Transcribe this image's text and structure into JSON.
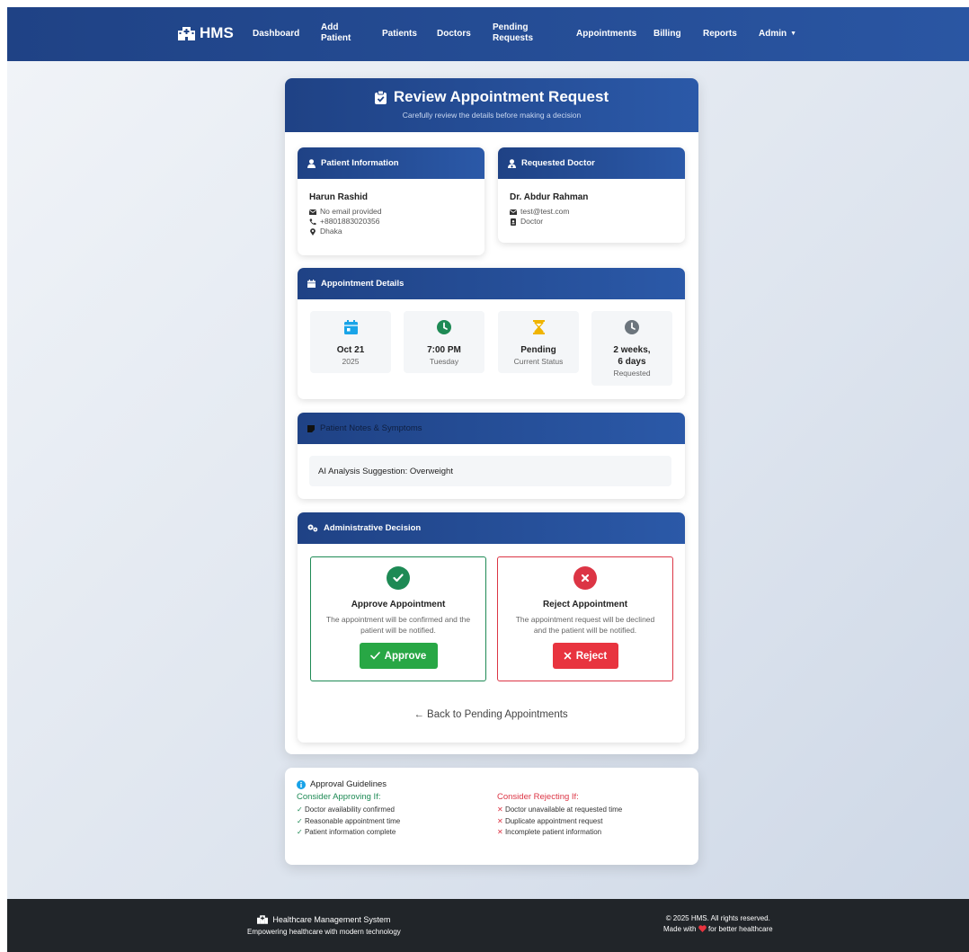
{
  "nav": {
    "brand": "HMS",
    "links": [
      "Dashboard",
      "Add Patient",
      "Patients",
      "Doctors",
      "Pending Requests",
      "Appointments",
      "Billing",
      "Reports"
    ],
    "admin": "Admin"
  },
  "header": {
    "title": "Review Appointment Request",
    "subtitle": "Carefully review the details before making a decision"
  },
  "patient": {
    "heading": "Patient Information",
    "name": "Harun Rashid",
    "email": "No email provided",
    "phone": "+8801883020356",
    "location": "Dhaka"
  },
  "doctor": {
    "heading": "Requested Doctor",
    "name": "Dr. Abdur Rahman",
    "email": "test@test.com",
    "role": "Doctor"
  },
  "details": {
    "heading": "Appointment Details",
    "date_main": "Oct 21",
    "date_sub": "2025",
    "time_main": "7:00 PM",
    "time_sub": "Tuesday",
    "status_main": "Pending",
    "status_sub": "Current Status",
    "ago_main_1": "2 weeks,",
    "ago_main_2": "6 days",
    "ago_sub": "Requested"
  },
  "notes": {
    "heading": "Patient Notes & Symptoms",
    "text": "AI Analysis Suggestion: Overweight"
  },
  "decision": {
    "heading": "Administrative Decision",
    "approve_title": "Approve Appointment",
    "approve_desc": "The appointment will be confirmed and the patient will be notified.",
    "approve_button": "Approve",
    "reject_title": "Reject Appointment",
    "reject_desc": "The appointment request will be declined and the patient will be notified.",
    "reject_button": "Reject",
    "back_link": "← Back to Pending Appointments"
  },
  "guidelines": {
    "heading": "Approval Guidelines",
    "approve_heading": "Consider Approving If:",
    "approve_items": [
      "Doctor availability confirmed",
      "Reasonable appointment time",
      "Patient information complete"
    ],
    "reject_heading": "Consider Rejecting If:",
    "reject_items": [
      "Doctor unavailable at requested time",
      "Duplicate appointment request",
      "Incomplete patient information"
    ]
  },
  "footer": {
    "title": "Healthcare Management System",
    "tagline": "Empowering healthcare with modern technology",
    "copyright": "© 2025 HMS. All rights reserved.",
    "made_prefix": "Made with",
    "made_suffix": "for better healthcare"
  },
  "colors": {
    "primary": "#1f4285",
    "success": "#1e8a55",
    "approve_button": "#28a745",
    "danger": "#dc3545",
    "warning": "#f0b400",
    "info": "#17a2e8"
  },
  "icons": [
    "hospital-icon",
    "clipboard-check-icon",
    "user-icon",
    "user-doctor-icon",
    "envelope-icon",
    "phone-icon",
    "map-marker-icon",
    "id-badge-icon",
    "calendar-icon",
    "clock-icon",
    "hourglass-icon",
    "history-icon",
    "sticky-note-icon",
    "cogs-icon",
    "check-icon",
    "times-icon",
    "info-circle-icon",
    "heart-icon"
  ]
}
